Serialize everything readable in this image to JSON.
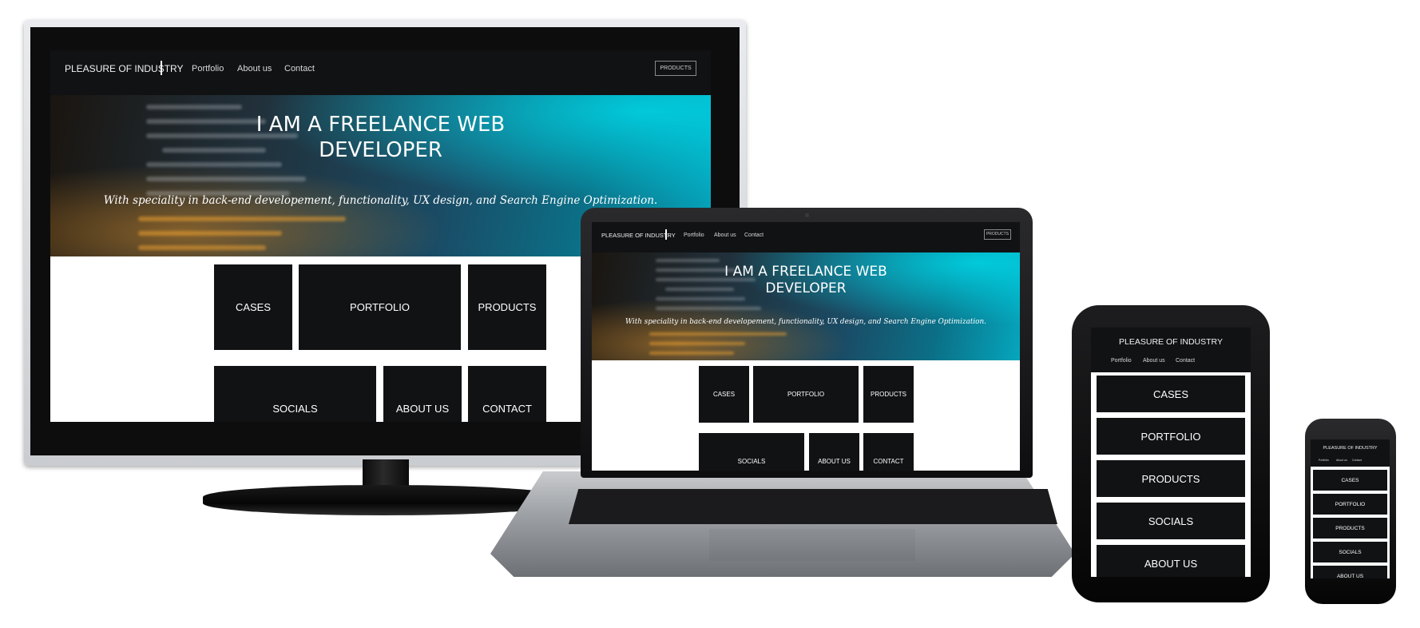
{
  "site": {
    "brand": "PLEASURE OF INDUSTRY",
    "nav": [
      "Portfolio",
      "About us",
      "Contact"
    ],
    "products_button": "PRODUCTS",
    "hero_title_line1": "I AM A FREELANCE WEB",
    "hero_title_line2": "DEVELOPER",
    "hero_subtitle": "With speciality in back-end developement, functionality, UX design, and Search Engine Optimization.",
    "tiles": {
      "cases": "CASES",
      "portfolio": "PORTFOLIO",
      "products": "PRODUCTS",
      "socials": "SOCIALS",
      "about": "ABOUT US",
      "contact": "CONTACT"
    }
  },
  "mobile_tiles": [
    "CASES",
    "PORTFOLIO",
    "PRODUCTS",
    "SOCIALS",
    "ABOUT US"
  ],
  "colors": {
    "nav_bg": "#111214",
    "tile_bg": "#111214",
    "accent_cyan": "#05a6bd"
  },
  "devices": [
    "desktop-monitor",
    "laptop",
    "tablet",
    "phone"
  ]
}
